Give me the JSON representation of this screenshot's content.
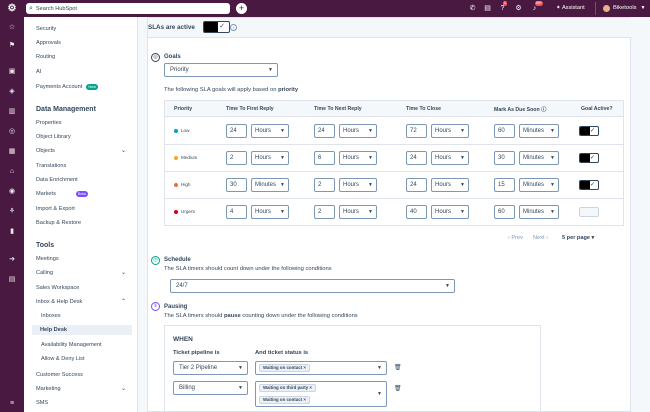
{
  "topbar": {
    "search_placeholder": "Search HubSpot",
    "assistant_label": "Assistant",
    "account_name": "Biketools",
    "badge_notifications": "1",
    "badge_count": "99+"
  },
  "sidebar": {
    "items": [
      {
        "label": "Security"
      },
      {
        "label": "Approvals"
      },
      {
        "label": "Routing"
      },
      {
        "label": "AI"
      },
      {
        "label": "Payments Account",
        "badge": "New"
      }
    ],
    "data_mgmt_title": "Data Management",
    "data_items": [
      {
        "label": "Properties"
      },
      {
        "label": "Object Library"
      },
      {
        "label": "Objects"
      },
      {
        "label": "Translations"
      },
      {
        "label": "Data Enrichment"
      },
      {
        "label": "Markets",
        "badge": "Beta"
      },
      {
        "label": "Import & Export"
      },
      {
        "label": "Backup & Restore"
      }
    ],
    "tools_title": "Tools",
    "tool_items": [
      {
        "label": "Meetings"
      },
      {
        "label": "Calling"
      },
      {
        "label": "Sales Workspace"
      },
      {
        "label": "Inbox & Help Desk"
      },
      {
        "label": "Inboxes"
      },
      {
        "label": "Help Desk"
      },
      {
        "label": "Availability Management"
      },
      {
        "label": "Allow & Deny List"
      },
      {
        "label": "Customer Success"
      },
      {
        "label": "Marketing"
      },
      {
        "label": "SMS"
      }
    ]
  },
  "sla": {
    "title": "SLAs are active",
    "toggle_on": true
  },
  "goals": {
    "title": "Goals",
    "select_value": "Priority",
    "description_prefix": "The following SLA goals will apply based on ",
    "description_bold": "priority",
    "columns": [
      "Priority",
      "Time To First Reply",
      "Time To Next Reply",
      "Time To Close",
      "Mark As Due Soon",
      "Goal Active?"
    ],
    "rows": [
      {
        "priority": "Low",
        "color": "#00a4bd",
        "first": "24",
        "first_unit": "Hours",
        "next": "24",
        "next_unit": "Hours",
        "close": "72",
        "close_unit": "Hours",
        "due": "60",
        "due_unit": "Minutes",
        "active": true
      },
      {
        "priority": "Medium",
        "color": "#f5a623",
        "first": "2",
        "first_unit": "Hours",
        "next": "6",
        "next_unit": "Hours",
        "close": "24",
        "close_unit": "Hours",
        "due": "30",
        "due_unit": "Minutes",
        "active": true
      },
      {
        "priority": "High",
        "color": "#e8703a",
        "first": "30",
        "first_unit": "Minutes",
        "next": "2",
        "next_unit": "Hours",
        "close": "24",
        "close_unit": "Hours",
        "due": "15",
        "due_unit": "Minutes",
        "active": true
      },
      {
        "priority": "Urgent",
        "color": "#d0021b",
        "first": "4",
        "first_unit": "Hours",
        "next": "2",
        "next_unit": "Hours",
        "close": "40",
        "close_unit": "Hours",
        "due": "60",
        "due_unit": "Minutes",
        "active": false
      }
    ],
    "pager": {
      "prev": "Prev",
      "next": "Next",
      "per_page": "5 per page"
    }
  },
  "schedule": {
    "title": "Schedule",
    "description": "The SLA timers should count down under the following conditions",
    "select_value": "24/7"
  },
  "pausing": {
    "title": "Pausing",
    "description_prefix": "The SLA timers should ",
    "description_bold": "pause",
    "description_suffix": " counting down under the following conditions",
    "when_label": "WHEN",
    "pipeline_label": "Ticket pipeline is",
    "status_label": "And ticket status is",
    "conditions": [
      {
        "pipeline": "Tier 2 Pipeline",
        "statuses": [
          "Waiting on contact"
        ]
      },
      {
        "pipeline": "Billing",
        "statuses": [
          "Waiting on third party",
          "Waiting on contact"
        ]
      }
    ]
  }
}
